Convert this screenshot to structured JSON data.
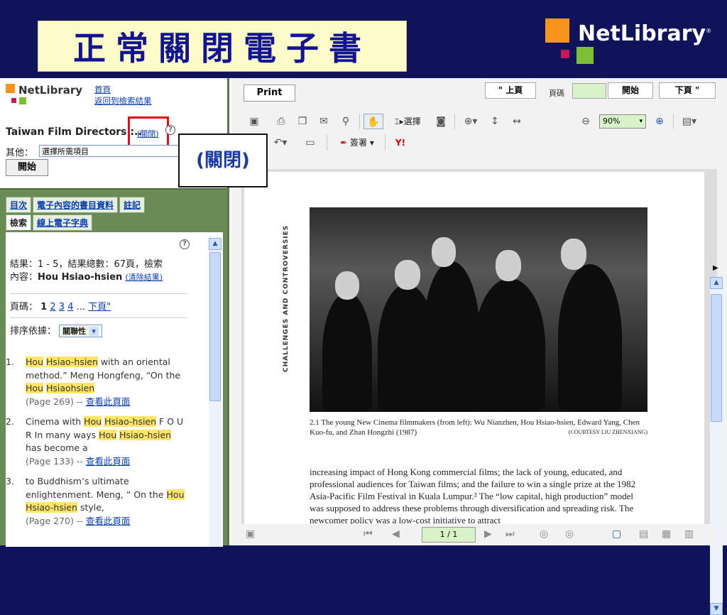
{
  "title": "正常關閉電子書",
  "brand": {
    "name": "NetLibrary",
    "mark": "®"
  },
  "left": {
    "logo": "NetLibrary",
    "links": [
      "首頁",
      "返回到檢索結果"
    ],
    "book_title": "Taiwan Film Directors :..",
    "close_link": "(關閉)",
    "help": "?",
    "other_label": "其他：",
    "other_select": "選擇所需項目",
    "start_button": "開始",
    "tabs_row1": [
      "目次",
      "電子內容的書目資料",
      "註記"
    ],
    "tabs_row2": [
      "檢索",
      "線上電子字典"
    ],
    "results_help": "?",
    "results_summary_line1": "結果：1 - 5，結果總數：67頁，檢索",
    "results_summary_line2_prefix": "內容：",
    "results_summary_term": "Hou Hsiao-hsien",
    "clear_results": "(清除結果)",
    "pager_label": "頁碼：",
    "pager_current": "1",
    "pager_pages": [
      "2",
      "3",
      "4"
    ],
    "pager_ellipsis": "...",
    "pager_next": "下頁\"",
    "sort_label": "排序依據：",
    "sort_value": "關聯性",
    "items": [
      {
        "num": "1.",
        "pre": "",
        "h1": "Hou",
        "mid1": " ",
        "h2": "Hsiao-hsien",
        "post1": " with an oriental method.” Meng Hongfeng, “On the ",
        "h3": "Hou",
        "mid2": " ",
        "h4": "Hsiaohsien",
        "post2": "",
        "page": "(Page 269) -- ",
        "view": "查看此頁面"
      },
      {
        "num": "2.",
        "pre": "Cinema with ",
        "h1": "Hou",
        "mid1": " ",
        "h2": "Hsiao-hsien",
        "post1": " F O U R In many ways ",
        "h3": "Hou",
        "mid2": " ",
        "h4": "Hsiao-hsien",
        "post2": " has become a",
        "page": "(Page 133) -- ",
        "view": "查看此頁面"
      },
      {
        "num": "3.",
        "pre": "to Buddhism’s ultimate enlightenment. Meng, ” On the ",
        "h1": "Hou",
        "mid1": " ",
        "h2": "Hsiao-hsien",
        "post1": " style,",
        "h3": "",
        "mid2": "",
        "h4": "",
        "post2": "",
        "page": "(Page 270) -- ",
        "view": "查看此頁面"
      }
    ]
  },
  "right": {
    "print_button": "Print",
    "prev_button": "\" 上頁",
    "page_label": "頁碼",
    "start_button": "開始",
    "next_button": "下頁 \"",
    "select_tool": "選擇",
    "zoom": "90%",
    "signature": "簽署",
    "close_callout": "(關閉)",
    "page_side_heading": "CHALLENGES AND CONTROVERSIES",
    "caption_main": "2.1 The young New Cinema filmmakers (from left): Wu Nianzhen, Hou Hsiao-hsien, Edward Yang, Chen Kuo-fu, and Zhan Hongzhi (1987)",
    "caption_credit": "(COURTESY LIU ZHENXIANG)",
    "body": "increasing impact of Hong Kong commercial films; the lack of young, educated, and professional audiences for Taiwan films; and the failure to win a single prize at the 1982 Asia-Pacific Film Festival in Kuala Lumpur.² The “low capital, high production” model was supposed to address these problems through diversification and spreading risk. The newcomer policy was a low-cost initiative to attract",
    "page_indicator": "1 / 1"
  }
}
